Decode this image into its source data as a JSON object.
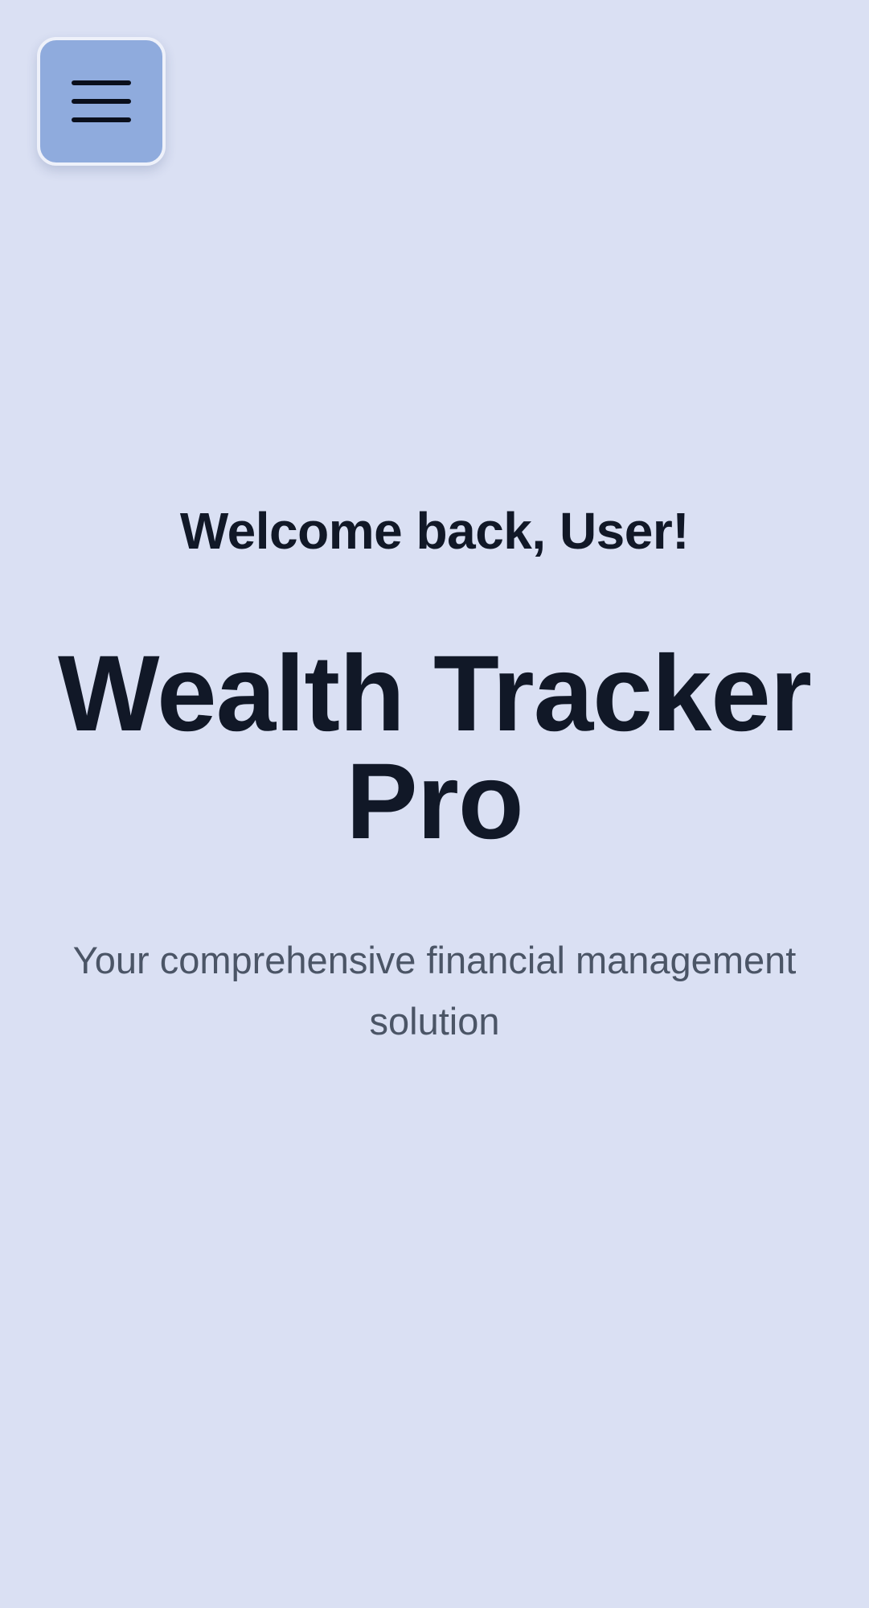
{
  "menu": {
    "icon": "hamburger-menu-icon",
    "button_color": "#8fabdd"
  },
  "hero": {
    "welcome": "Welcome back, User!",
    "title": "Wealth Tracker Pro",
    "subtitle": "Your comprehensive financial management solution"
  },
  "colors": {
    "background": "#dae0f3",
    "heading_text": "#111827",
    "subtitle_text": "#4b5566"
  }
}
